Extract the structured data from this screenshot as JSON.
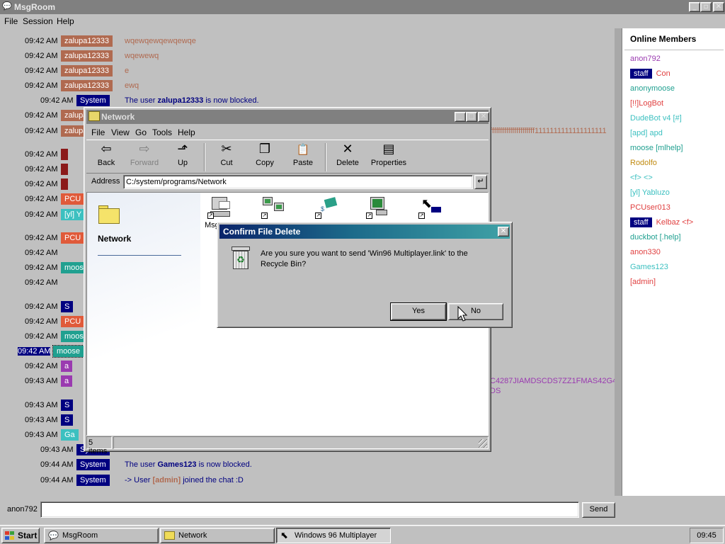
{
  "msgroom": {
    "title": "MsgRoom",
    "title_icon": "speech-bubble-icon",
    "menu": [
      "File",
      "Session",
      "Help"
    ],
    "controls": {
      "minimize": "_",
      "maximize": "▫",
      "close": "✕"
    },
    "chat": [
      {
        "time": "09:42 AM",
        "user": "zalupa12333",
        "user_color": "#b06a50",
        "message": "wqewqewqewqewqe",
        "msg_color": "#b06a50"
      },
      {
        "time": "09:42 AM",
        "user": "zalupa12333",
        "user_color": "#b06a50",
        "message": "wqewewq",
        "msg_color": "#b06a50"
      },
      {
        "time": "09:42 AM",
        "user": "zalupa12333",
        "user_color": "#b06a50",
        "message": "e",
        "msg_color": "#b06a50"
      },
      {
        "time": "09:42 AM",
        "user": "zalupa12333",
        "user_color": "#b06a50",
        "message": "ewq",
        "msg_color": "#b06a50"
      },
      {
        "time": "09:42 AM",
        "user": "System",
        "user_color": "#000080",
        "message_parts": [
          "The user ",
          "zalupa12333",
          " is now blocked."
        ],
        "msg_color": "#000080"
      },
      {
        "time": "09:42 AM",
        "user": "zalupa12333",
        "user_color": "#b06a50",
        "message": "",
        "msg_color": "#b06a50"
      },
      {
        "time": "09:42 AM",
        "user": "zalupa12333",
        "user_color": "#b06a50",
        "message": "",
        "msg_color": "#b06a50",
        "tail": "ffffffffffffffffffffff1111111111111111111"
      },
      {
        "time": "09:42 AM",
        "user": "",
        "user_color": "#8b1a1a",
        "message": ""
      },
      {
        "time": "09:42 AM",
        "user": "",
        "user_color": "#8b1a1a",
        "message": ""
      },
      {
        "time": "09:42 AM",
        "user": "",
        "user_color": "#8b1a1a",
        "message": ""
      },
      {
        "time": "09:42 AM",
        "user": "PCU",
        "user_color": "#e05a3a",
        "message": ""
      },
      {
        "time": "09:42 AM",
        "user": "[yl] Y",
        "user_color": "#3cc0c0",
        "message": ""
      },
      {
        "time": "09:42 AM",
        "user": "PCU",
        "user_color": "#e05a3a",
        "message": ""
      },
      {
        "time": "09:42 AM",
        "user": "",
        "user_color": "",
        "message": ""
      },
      {
        "time": "09:42 AM",
        "user": "moose",
        "user_color": "#20a090",
        "message": ""
      },
      {
        "time": "09:42 AM",
        "user": "",
        "user_color": "",
        "message": ""
      },
      {
        "time": "09:42 AM",
        "user": "S",
        "user_color": "#000080",
        "message": ""
      },
      {
        "time": "09:42 AM",
        "user": "PCU",
        "user_color": "#e05a3a",
        "message": ""
      },
      {
        "time": "09:42 AM",
        "user": "moose",
        "user_color": "#20a090",
        "message": ""
      },
      {
        "time": "09:42 AM",
        "user": "moose",
        "user_color": "#20a090",
        "message": "",
        "selected": true
      },
      {
        "time": "09:42 AM",
        "user": "a",
        "user_color": "#9a3ab0",
        "message": ""
      },
      {
        "time": "09:43 AM",
        "user": "a",
        "user_color": "#9a3ab0",
        "message": "",
        "tail": "C4287JIAMDSCDS7ZZ1FMAS42G4",
        "tail2": "DS"
      },
      {
        "time": "09:43 AM",
        "user": "S",
        "user_color": "#000080",
        "message": ""
      },
      {
        "time": "09:43 AM",
        "user": "S",
        "user_color": "#000080",
        "message": ""
      },
      {
        "time": "09:43 AM",
        "user": "Ga",
        "user_color": "#3cc0c0",
        "message": ""
      },
      {
        "time": "09:43 AM",
        "user": "System",
        "user_color": "#000080",
        "message": ""
      },
      {
        "time": "09:44 AM",
        "user": "System",
        "user_color": "#000080",
        "message_parts": [
          "The user ",
          "Games123",
          " is now blocked."
        ],
        "msg_color": "#000080"
      },
      {
        "time": "09:44 AM",
        "user": "System",
        "user_color": "#000080",
        "message_parts": [
          "-> User ",
          "[admin]",
          " joined the chat :D"
        ],
        "msg_color": "#000080",
        "highlight_color": "#b06a50"
      }
    ],
    "members_title": "Online Members",
    "members": [
      {
        "name": "anon792",
        "color": "#9a3ab0"
      },
      {
        "staff": "staff",
        "name": "Con",
        "color": "#e04040"
      },
      {
        "name": "anonymoose",
        "color": "#20a090"
      },
      {
        "name": "[!!]LogBot",
        "color": "#e04040"
      },
      {
        "name": "DudeBot v4 [#]",
        "color": "#3cc0c0"
      },
      {
        "name": "[apd] apd",
        "color": "#3cc0c0"
      },
      {
        "name": "moose [mlhelp]",
        "color": "#20a090"
      },
      {
        "name": "Rodolfo",
        "color": "#c08a10"
      },
      {
        "name": "<f> <>",
        "color": "#3cc0c0"
      },
      {
        "name": "[yl] Yabluzo",
        "color": "#3cc0c0"
      },
      {
        "name": "PCUser013",
        "color": "#e04040"
      },
      {
        "staff": "staff",
        "name": "Kelbaz <f>",
        "color": "#e04040"
      },
      {
        "name": "duckbot [.help]",
        "color": "#20a090"
      },
      {
        "name": "anon330",
        "color": "#e04040"
      },
      {
        "name": "Games123",
        "color": "#3cc0c0"
      },
      {
        "name": "[admin]",
        "color": "#e04040"
      }
    ],
    "username": "anon792",
    "input_value": "",
    "send_label": "Send"
  },
  "network": {
    "title": "Network",
    "menu": [
      "File",
      "View",
      "Go",
      "Tools",
      "Help"
    ],
    "toolbar": [
      {
        "label": "Back",
        "icon": "back-arrow-icon",
        "glyph": "⇦",
        "disabled": false
      },
      {
        "label": "Forward",
        "icon": "forward-arrow-icon",
        "glyph": "⇨",
        "disabled": true
      },
      {
        "label": "Up",
        "icon": "up-folder-icon",
        "glyph": "⬏",
        "disabled": false
      },
      {
        "label": "Cut",
        "icon": "scissors-icon",
        "glyph": "✂",
        "disabled": false
      },
      {
        "label": "Copy",
        "icon": "copy-icon",
        "glyph": "❐",
        "disabled": false
      },
      {
        "label": "Paste",
        "icon": "paste-icon",
        "glyph": "📋",
        "disabled": false
      },
      {
        "label": "Delete",
        "icon": "delete-x-icon",
        "glyph": "✕",
        "disabled": false
      },
      {
        "label": "Properties",
        "icon": "properties-icon",
        "glyph": "▤",
        "disabled": false
      }
    ],
    "address_label": "Address",
    "address_value": "C:/system/programs/Network",
    "side_title": "Network",
    "partial_item_label": "Msg",
    "status": "5 items"
  },
  "dialog": {
    "title": "Confirm File Delete",
    "message": "Are you sure you want to send 'Win96 Multiplayer.link' to the Recycle Bin?",
    "yes_label": "Yes",
    "no_label": "No",
    "close": "✕"
  },
  "taskbar": {
    "start_label": "Start",
    "tasks": [
      {
        "label": "MsgRoom",
        "icon": "speech-bubble-icon"
      },
      {
        "label": "Network",
        "icon": "folder-icon"
      },
      {
        "label": "Windows 96 Multiplayer",
        "icon": "multiplayer-icon"
      }
    ],
    "clock": "09:45"
  }
}
